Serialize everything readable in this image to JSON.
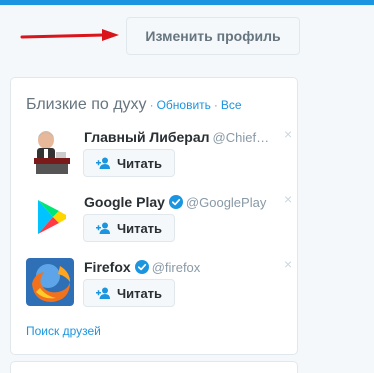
{
  "header": {
    "edit_profile_label": "Изменить профиль"
  },
  "who_to_follow": {
    "title": "Близкие по духу",
    "refresh_label": "Обновить",
    "separator": "·",
    "all_label": "Все",
    "find_friends_label": "Поиск друзей",
    "users": [
      {
        "name": "Главный Либерал",
        "handle": "@Chief…",
        "verified": false,
        "follow_label": "Читать",
        "dismiss": "×",
        "avatar_icon": "cartoon-politician-avatar"
      },
      {
        "name": "Google Play",
        "handle": "@GooglePlay",
        "verified": true,
        "follow_label": "Читать",
        "dismiss": "×",
        "avatar_icon": "google-play-logo"
      },
      {
        "name": "Firefox",
        "handle": "@firefox",
        "verified": true,
        "follow_label": "Читать",
        "dismiss": "×",
        "avatar_icon": "firefox-logo"
      }
    ]
  },
  "colors": {
    "accent": "#1b95e0",
    "arrow": "#d9141b",
    "background": "#f5f8fa"
  }
}
